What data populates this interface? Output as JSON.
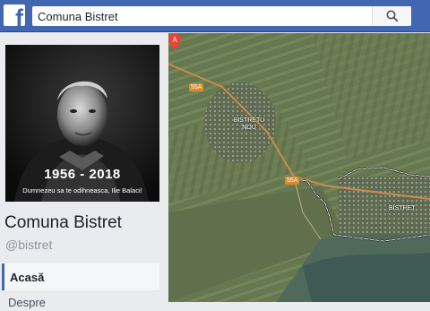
{
  "header": {
    "logo": "f",
    "search": {
      "value": "Comuna Bistret"
    }
  },
  "sidebar": {
    "cover": {
      "years": "1956 - 2018",
      "motto": "Dumnezeu sa te odihneasca, Ilie Balaci!"
    },
    "page_name": "Comuna Bistret",
    "handle": "@bistret",
    "nav": [
      {
        "label": "Acasă"
      },
      {
        "label": "Despre"
      }
    ]
  },
  "map": {
    "road_labels": [
      "55A",
      "55A"
    ],
    "places": [
      "BISTREȚU NOU",
      "BISTREȚ"
    ],
    "pin_letter": "A"
  },
  "colors": {
    "brand": "#4267b2",
    "pin": "#ea4335",
    "road": "#d98a2b"
  }
}
